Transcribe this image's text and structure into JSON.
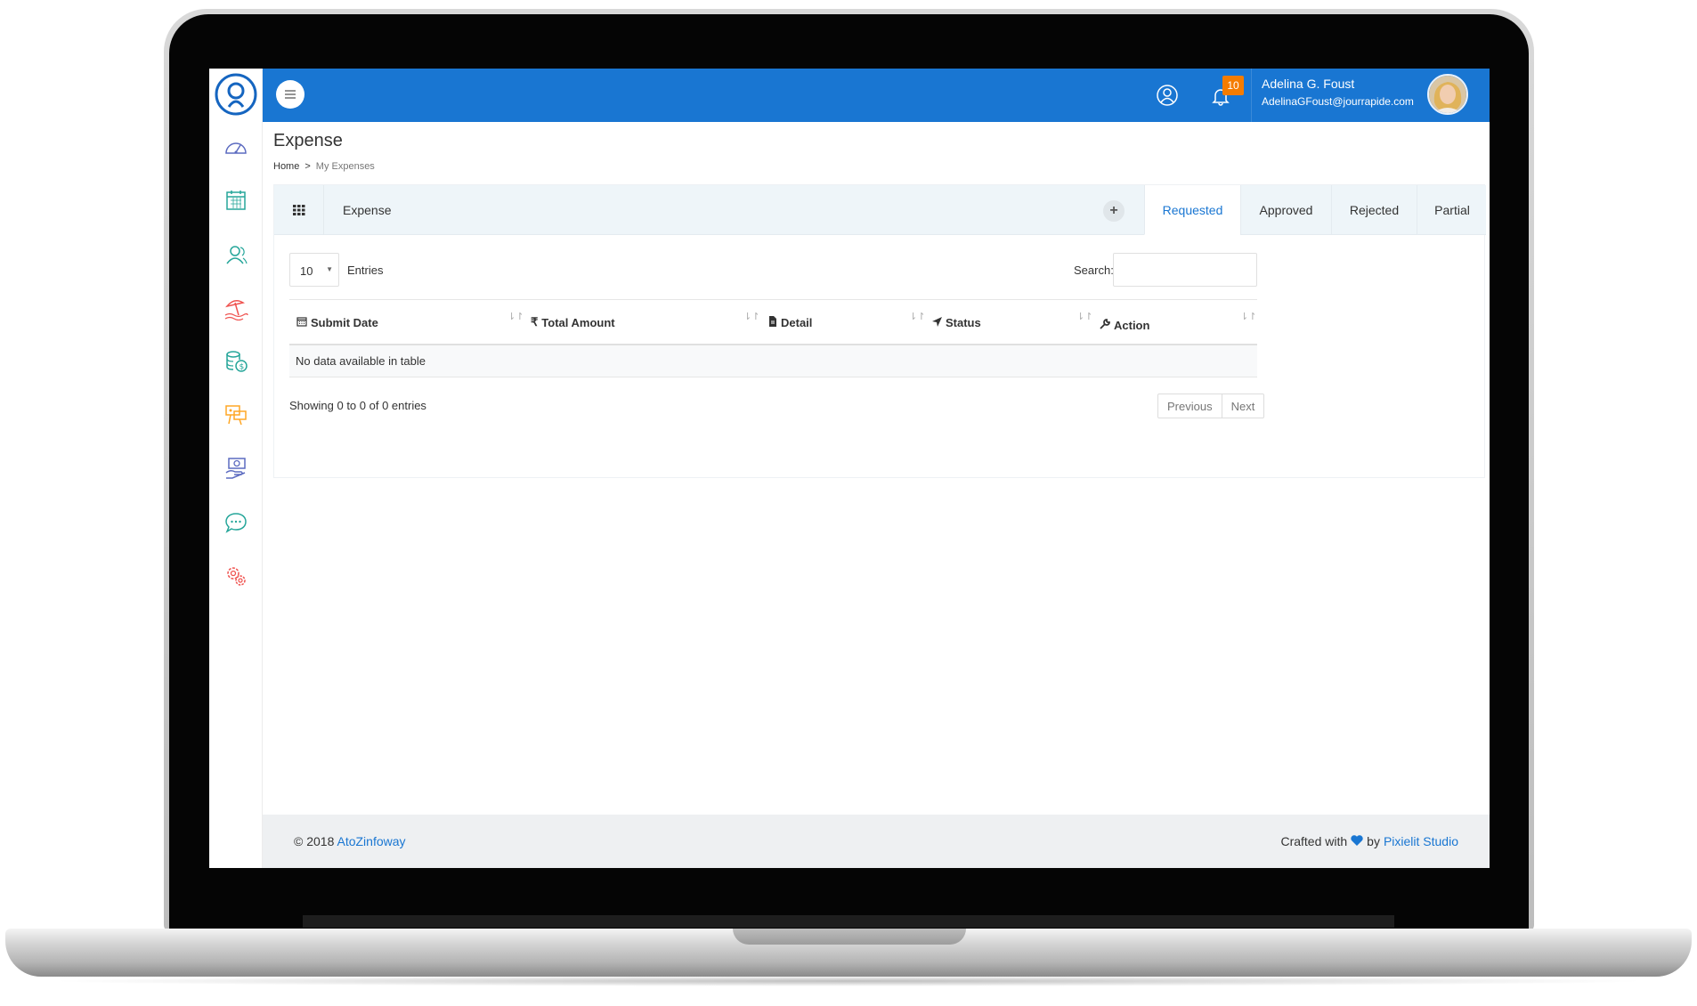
{
  "header": {
    "user_name": "Adelina G. Foust",
    "user_email": "AdelinaGFoust@jourrapide.com",
    "notification_count": "10",
    "accent_color": "#1976d2",
    "badge_color": "#f57c00"
  },
  "sidebar": {
    "items": [
      {
        "icon": "dashboard-gauge-icon",
        "color": "#5c6bc0"
      },
      {
        "icon": "calendar-icon",
        "color": "#26a69a"
      },
      {
        "icon": "users-icon",
        "color": "#26a69a"
      },
      {
        "icon": "holiday-beach-icon",
        "color": "#ef5350"
      },
      {
        "icon": "expense-coins-icon",
        "color": "#26a69a"
      },
      {
        "icon": "presentation-icon",
        "color": "#ffa726"
      },
      {
        "icon": "payroll-icon",
        "color": "#5c6bc0"
      },
      {
        "icon": "chat-icon",
        "color": "#26a69a"
      },
      {
        "icon": "settings-gears-icon",
        "color": "#ef5350"
      }
    ]
  },
  "page": {
    "title": "Expense",
    "breadcrumb": {
      "home": "Home",
      "separator": ">",
      "current": "My Expenses"
    }
  },
  "panel": {
    "title": "Expense",
    "add_symbol": "+",
    "tabs": [
      "Requested",
      "Approved",
      "Rejected",
      "Partial"
    ],
    "active_tab": "Requested"
  },
  "table": {
    "entries_value": "10",
    "entries_label": "Entries",
    "search_label": "Search:",
    "columns": [
      "Submit Date",
      "Total Amount",
      "Detail",
      "Status",
      "Action"
    ],
    "empty_message": "No data available in table",
    "showing": "Showing 0 to 0 of 0 entries",
    "pager": {
      "previous": "Previous",
      "next": "Next"
    }
  },
  "footer": {
    "copyright": "© 2018",
    "company": "AtoZinfoway",
    "crafted_prefix": "Crafted with",
    "crafted_by": "by",
    "studio": "Pixielit Studio"
  }
}
